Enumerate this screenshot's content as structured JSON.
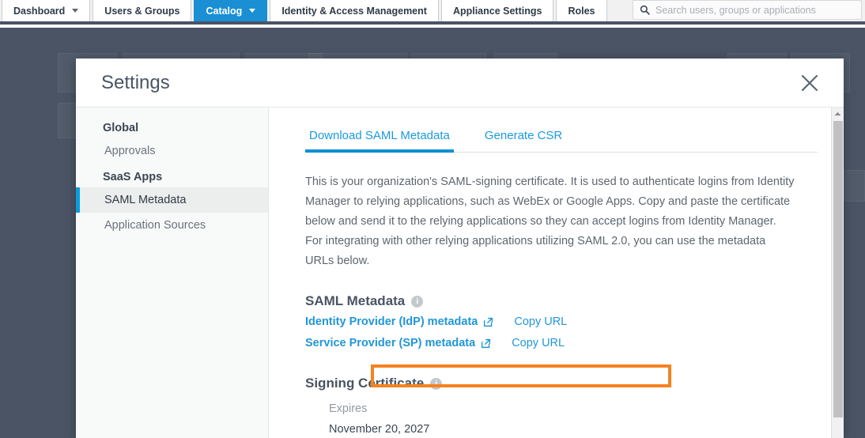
{
  "topnav": {
    "tabs": [
      {
        "label": "Dashboard",
        "has_caret": true,
        "active": false
      },
      {
        "label": "Users & Groups",
        "has_caret": false,
        "active": false
      },
      {
        "label": "Catalog",
        "has_caret": true,
        "active": true
      },
      {
        "label": "Identity & Access Management",
        "has_caret": false,
        "active": false
      },
      {
        "label": "Appliance Settings",
        "has_caret": false,
        "active": false
      },
      {
        "label": "Roles",
        "has_caret": false,
        "active": false
      }
    ],
    "search": {
      "placeholder": "Search users, groups or applications",
      "value": "",
      "icon": "search-icon"
    }
  },
  "dialog": {
    "title": "Settings",
    "close_icon": "close-icon",
    "sidebar": {
      "sections": [
        {
          "group": "Global",
          "items": [
            {
              "label": "Approvals",
              "selected": false
            }
          ]
        },
        {
          "group": "SaaS Apps",
          "items": [
            {
              "label": "SAML Metadata",
              "selected": true
            },
            {
              "label": "Application Sources",
              "selected": false
            }
          ]
        }
      ]
    },
    "main": {
      "tabs": [
        {
          "label": "Download SAML Metadata",
          "active": true
        },
        {
          "label": "Generate CSR",
          "active": false
        }
      ],
      "description": "This is your organization's SAML-signing certificate. It is used to authenticate logins from Identity Manager to relying applications, such as WebEx or Google Apps. Copy and paste the certificate below and send it to the relying applications so they can accept logins from Identity Manager. For integrating with other relying applications utilizing SAML 2.0, you can use the metadata URLs below.",
      "saml_metadata": {
        "heading": "SAML Metadata",
        "info_glyph": "i",
        "links": [
          {
            "label": "Identity Provider (IdP) metadata",
            "external_icon": "external-link-icon",
            "copy_label": "Copy URL",
            "highlighted": true
          },
          {
            "label": "Service Provider (SP) metadata",
            "external_icon": "external-link-icon",
            "copy_label": "Copy URL",
            "highlighted": false
          }
        ]
      },
      "signing_certificate": {
        "heading": "Signing Certificate",
        "info_glyph": "i",
        "expires_label": "Expires",
        "expires_value": "November 20, 2027"
      }
    }
  },
  "colors": {
    "accent_blue": "#1a8fd4",
    "link_blue": "#2196d8",
    "highlight_orange": "#f58220",
    "backdrop": "#4a5464",
    "sidebar_bg": "#f8f9f9"
  }
}
